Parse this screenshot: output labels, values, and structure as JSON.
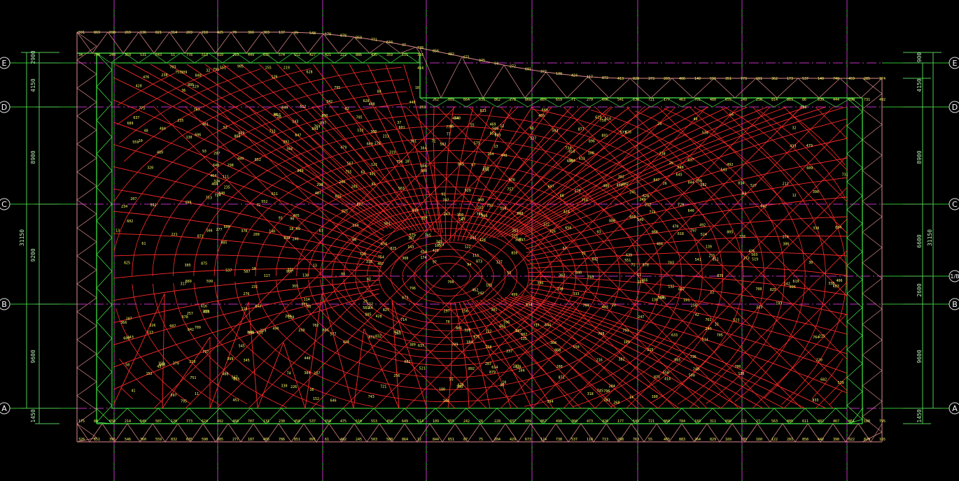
{
  "drawing": {
    "axes_left": [
      "E",
      "D",
      "C",
      "B",
      "A"
    ],
    "axes_right": [
      "E",
      "D",
      "C",
      "1/B",
      "B",
      "A"
    ],
    "dimensions_left": [
      "2900",
      "4150",
      "8900",
      "31150",
      "9200",
      "9600",
      "1450"
    ],
    "dimensions_right": [
      "900",
      "4150",
      "8900",
      "31150",
      "6600",
      "2600",
      "9600",
      "1450"
    ],
    "colors": {
      "background": "#000000",
      "grid_line": "#cc33cc",
      "column_line": "#33cc33",
      "mesh_red": "#ff2a2a",
      "mesh_pink": "#e08a8a",
      "edge_green": "#44ee44",
      "dimension": "#66dd66",
      "node_label": "#ffff66"
    }
  }
}
